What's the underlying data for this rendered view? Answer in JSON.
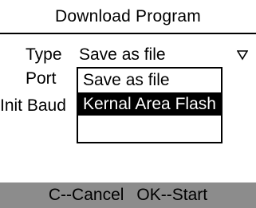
{
  "title": "Download Program",
  "fields": {
    "type_label": "Type",
    "port_label": "Port",
    "baud_label": "Init Baud"
  },
  "type_select": {
    "value": "Save as file",
    "arrow_icon": "dropdown-triangle-icon",
    "options": [
      {
        "label": "Save as file",
        "highlighted": false
      },
      {
        "label": "Kernal Area Flash",
        "highlighted": true
      }
    ]
  },
  "footer": {
    "cancel": "C--Cancel",
    "start": "OK--Start"
  },
  "colors": {
    "background": "#ffffff",
    "text": "#000000",
    "highlight": "#000000",
    "highlight_text": "#ffffff",
    "footer_bar": "#8c8c8c"
  }
}
